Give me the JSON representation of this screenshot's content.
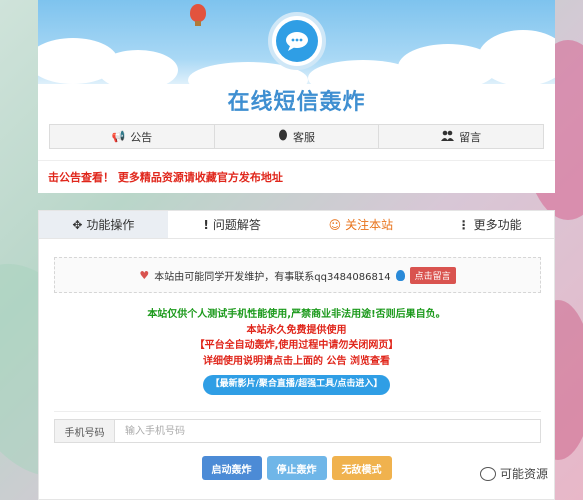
{
  "site": {
    "title": "在线短信轰炸"
  },
  "nav": {
    "items": [
      {
        "label": "公告",
        "icon": "megaphone-icon"
      },
      {
        "label": "客服",
        "icon": "qq-penguin-icon"
      },
      {
        "label": "留言",
        "icon": "users-icon"
      }
    ]
  },
  "marquee": {
    "text": "击公告查看！ 更多精品资源请收藏官方发布地址"
  },
  "tabs": [
    {
      "label": "功能操作",
      "icon": "cursor-move-icon",
      "active": true
    },
    {
      "label": "问题解答",
      "icon": "exclamation-icon",
      "active": false
    },
    {
      "label": "关注本站",
      "icon": "smile-icon",
      "active": false
    },
    {
      "label": "更多功能",
      "icon": "more-icon",
      "active": false
    }
  ],
  "notice": {
    "text": "本站由可能同学开发维护，有事联系qq3484086814",
    "button": "点击留言"
  },
  "info": {
    "line1": "本站仅供个人测试手机性能使用,严禁商业非法用途!否则后果自负。",
    "line2": "本站永久免费提供使用",
    "line3": "【平台全自动轰炸,使用过程中请勿关闭网页】",
    "line4": "详细使用说明请点击上面的 公告 浏览查看",
    "links": "【最新影片/聚合直播/超强工具/点击进入】"
  },
  "form": {
    "phone_label": "手机号码",
    "phone_placeholder": "输入手机号码",
    "phone_value": ""
  },
  "buttons": {
    "start": "启动轰炸",
    "stop": "停止轰炸",
    "god": "无敌模式"
  },
  "watermark": {
    "text": "可能资源"
  },
  "colors": {
    "accent": "#3f8fd1",
    "marquee": "#e0261b",
    "tab_active": "#eaeef3",
    "follow": "#e8731b",
    "start_btn": "#4c8bd6",
    "stop_btn": "#6fb6e8",
    "god_btn": "#f0b24e"
  }
}
